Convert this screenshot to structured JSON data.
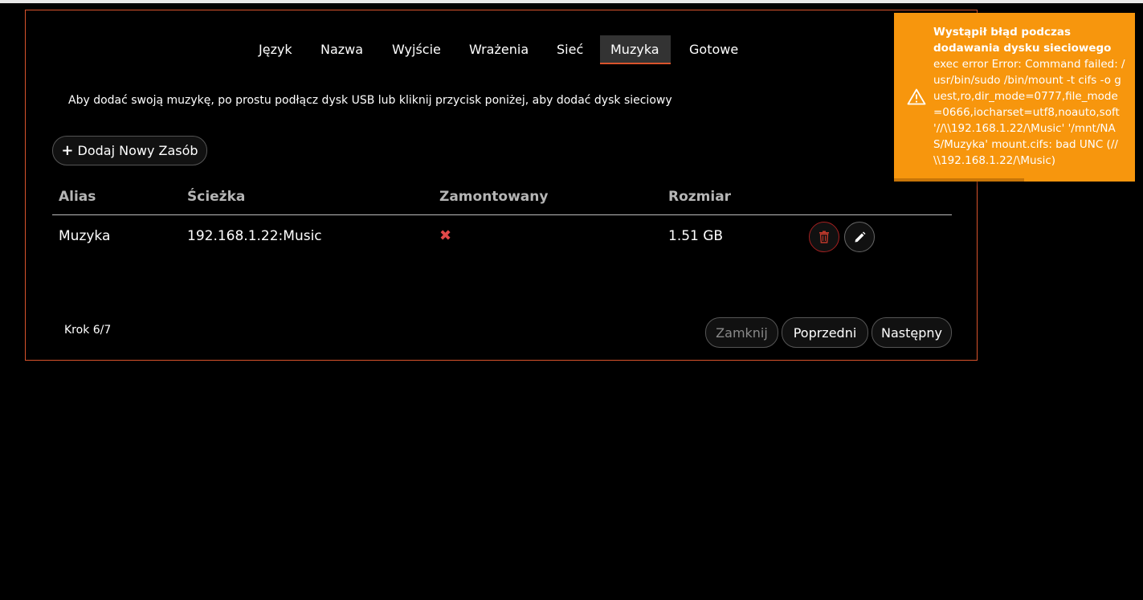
{
  "tabs": [
    {
      "label": "Język"
    },
    {
      "label": "Nazwa"
    },
    {
      "label": "Wyjście"
    },
    {
      "label": "Wrażenia"
    },
    {
      "label": "Sieć"
    },
    {
      "label": "Muzyka",
      "active": true
    },
    {
      "label": "Gotowe"
    }
  ],
  "intro_text": "Aby dodać swoją muzykę, po prostu podłącz dysk USB lub kliknij przycisk poniżej, aby dodać dysk sieciowy",
  "add_button": {
    "icon": "plus-icon",
    "label": "Dodaj Nowy Zasób"
  },
  "table": {
    "headers": [
      "Alias",
      "Ścieżka",
      "Zamontowany",
      "Rozmiar"
    ],
    "rows": [
      {
        "alias": "Muzyka",
        "path": "192.168.1.22:Music",
        "mounted": "✖",
        "size": "1.51 GB"
      }
    ]
  },
  "row_actions": {
    "delete_icon": "trash-icon",
    "edit_icon": "pencil-icon"
  },
  "footer": {
    "step": "Krok 6/7",
    "close_label": "Zamknij",
    "prev_label": "Poprzedni",
    "next_label": "Następny"
  },
  "toast": {
    "title": "Wystąpił błąd podczas dodawania dysku sieciowego",
    "message": "exec error Error: Command failed: /usr/bin/sudo /bin/mount -t cifs -o guest,ro,dir_mode=0777,file_mode=0666,iocharset=utf8,noauto,soft '//\\\\192.168.1.22/\\Music' '/mnt/NAS/Muzyka' mount.cifs: bad UNC (//\\\\192.168.1.22/\\Music)",
    "icon": "warning-icon"
  },
  "colors": {
    "accent": "#d9532c",
    "toast_bg": "#f7960d",
    "error_red": "#e04848",
    "background": "#000000"
  }
}
